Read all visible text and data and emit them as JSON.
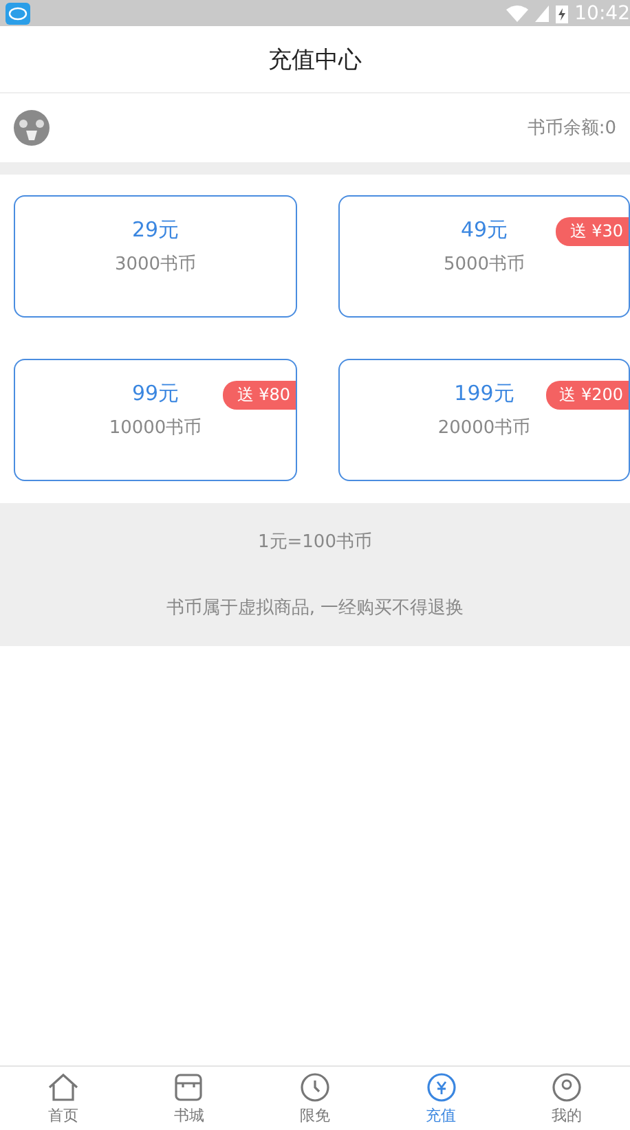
{
  "status_bar": {
    "time": "10:42"
  },
  "header": {
    "title": "充值中心"
  },
  "account": {
    "balance": "书币余额:0"
  },
  "packages": [
    {
      "price": "29元",
      "coins": "3000书币"
    },
    {
      "price": "49元",
      "coins": "5000书币",
      "bonus": "送 ¥30"
    },
    {
      "price": "99元",
      "coins": "10000书币",
      "bonus": "送 ¥80"
    },
    {
      "price": "199元",
      "coins": "20000书币",
      "bonus": "送 ¥200"
    }
  ],
  "notes": [
    "1元=100书币",
    "书币属于虚拟商品, 一经购买不得退换"
  ],
  "nav": [
    {
      "label": "首页",
      "selected": false
    },
    {
      "label": "书城",
      "selected": false
    },
    {
      "label": "限免",
      "selected": false
    },
    {
      "label": "充值",
      "selected": true
    },
    {
      "label": "我的",
      "selected": false
    }
  ]
}
